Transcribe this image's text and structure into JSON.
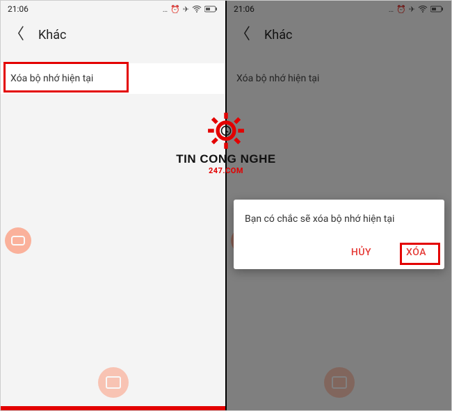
{
  "status": {
    "time": "21:06"
  },
  "header": {
    "title": "Khác"
  },
  "list": {
    "clear_cache": "Xóa bộ nhớ hiện tại"
  },
  "dialog": {
    "message": "Bạn có chắc sẽ xóa bộ nhớ hiện tại",
    "cancel": "HỦY",
    "confirm": "XÓA"
  },
  "watermark": {
    "line1": "TIN CONG NGHE",
    "line2": "247.COM"
  }
}
